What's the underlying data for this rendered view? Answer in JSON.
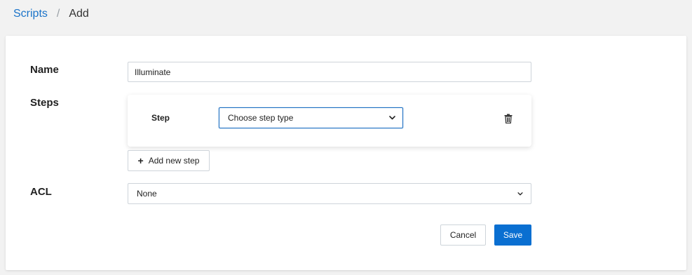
{
  "breadcrumb": {
    "parent": "Scripts",
    "separator": "/",
    "current": "Add"
  },
  "form": {
    "name_label": "Name",
    "name_value": "Illuminate",
    "steps_label": "Steps",
    "step": {
      "label": "Step",
      "select_value": "Choose step type",
      "delete_icon": "trash-icon"
    },
    "add_step_label": "Add new step",
    "acl_label": "ACL",
    "acl_value": "None",
    "cancel_label": "Cancel",
    "save_label": "Save"
  },
  "colors": {
    "accent": "#0a6fd1",
    "link": "#1a73c9",
    "background": "#f2f2f2"
  }
}
